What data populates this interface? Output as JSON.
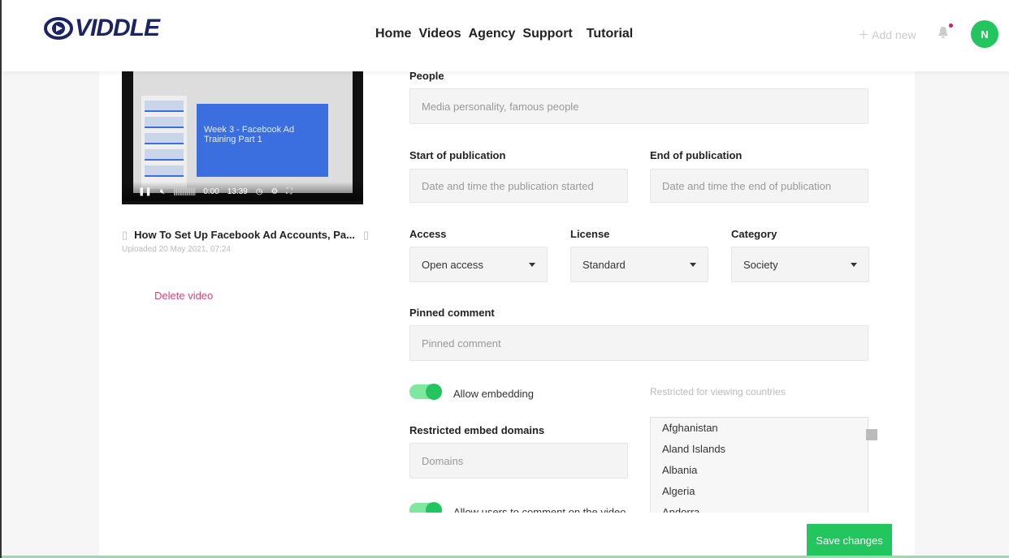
{
  "brand": {
    "name": "VIDDLE"
  },
  "nav": [
    "Home",
    "Videos",
    "Agency",
    "Support",
    "Tutorial"
  ],
  "header": {
    "add_new": "Add new",
    "avatar_initial": "N"
  },
  "video": {
    "slide_text": "Week 3 - Facebook Ad Training Part 1",
    "current_time": "0:00",
    "duration": "13:39",
    "title": "How To Set Up Facebook Ad Accounts, Pa...",
    "uploaded": "Uploaded 20 May 2021, 07:24",
    "delete_label": "Delete video"
  },
  "form": {
    "people": {
      "label": "People",
      "placeholder": "Media personality, famous people"
    },
    "start": {
      "label": "Start of publication",
      "placeholder": "Date and time the publication started"
    },
    "end": {
      "label": "End of publication",
      "placeholder": "Date and time the end of publication"
    },
    "access": {
      "label": "Access",
      "value": "Open access"
    },
    "license": {
      "label": "License",
      "value": "Standard"
    },
    "category": {
      "label": "Category",
      "value": "Society"
    },
    "pinned": {
      "label": "Pinned comment",
      "placeholder": "Pinned comment"
    },
    "allow_embedding": {
      "label": "Allow embedding",
      "on": true
    },
    "countries": {
      "label": "Restricted for viewing countries",
      "options": [
        "Afghanistan",
        "Aland Islands",
        "Albania",
        "Algeria",
        "Andorra"
      ]
    },
    "domains": {
      "label": "Restricted embed domains",
      "placeholder": "Domains"
    },
    "allow_comments": {
      "label": "Allow users to comment on the video",
      "on": true
    }
  },
  "save_label": "Save changes",
  "colors": {
    "accent": "#22c55e",
    "brand": "#1c2466",
    "danger": "#d6457a"
  }
}
